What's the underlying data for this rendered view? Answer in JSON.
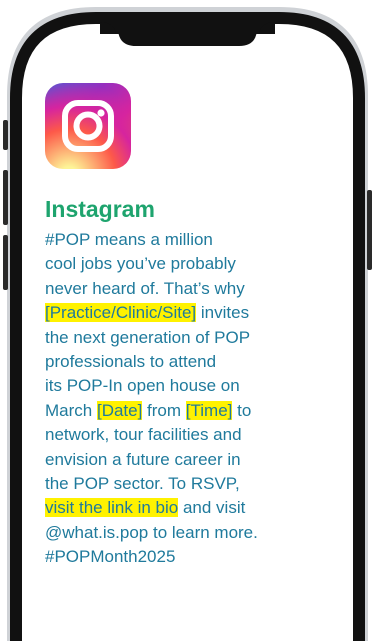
{
  "app": {
    "name": "Instagram",
    "icon": "instagram-icon"
  },
  "post": {
    "lines": [
      [
        {
          "t": "#POP means a million"
        }
      ],
      [
        {
          "t": "cool jobs you’ve probably"
        }
      ],
      [
        {
          "t": "never heard of. That’s why"
        }
      ],
      [
        {
          "t": "[Practice/Clinic/Site]",
          "hl": true
        },
        {
          "t": " invites"
        }
      ],
      [
        {
          "t": "the next generation of POP"
        }
      ],
      [
        {
          "t": "professionals to attend"
        }
      ],
      [
        {
          "t": "its POP-In open house on"
        }
      ],
      [
        {
          "t": "March "
        },
        {
          "t": "[Date]",
          "hl": true
        },
        {
          "t": " from "
        },
        {
          "t": "[Time]",
          "hl": true
        },
        {
          "t": " to"
        }
      ],
      [
        {
          "t": "network, tour facilities and"
        }
      ],
      [
        {
          "t": "envision a future career in"
        }
      ],
      [
        {
          "t": "the POP sector. To RSVP,"
        }
      ],
      [
        {
          "t": "visit the link in bio",
          "hl": true
        },
        {
          "t": " and visit"
        }
      ],
      [
        {
          "t": "@what.is.pop to learn more."
        }
      ],
      [
        {
          "t": "#POPMonth2025"
        }
      ]
    ]
  },
  "colors": {
    "title": "#1ea46e",
    "body": "#1f7a9c",
    "highlight": "#fff200",
    "frame": "#111111"
  }
}
